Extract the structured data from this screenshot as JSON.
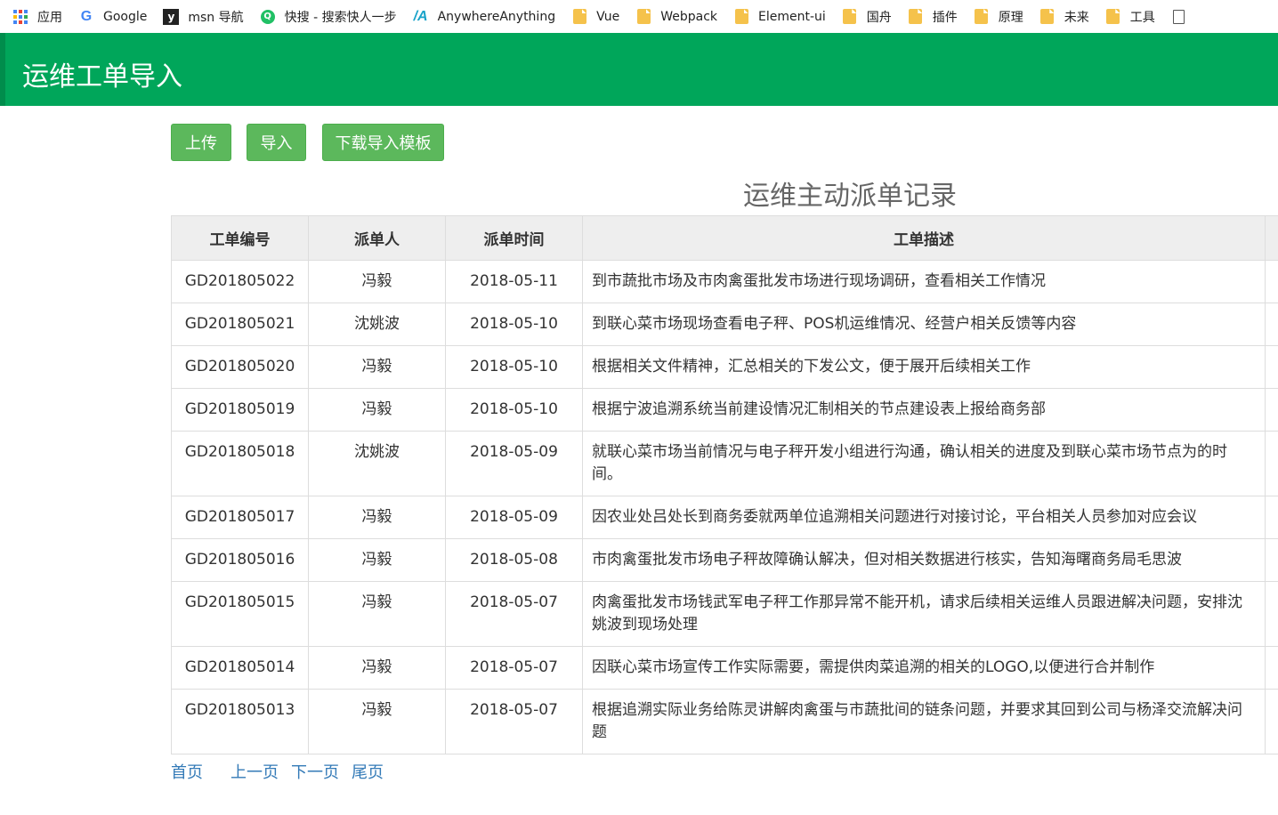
{
  "bookmarks": [
    {
      "label": "应用",
      "icon": "apps-grid-icon"
    },
    {
      "label": "Google",
      "icon": "google-icon"
    },
    {
      "label": "msn 导航",
      "icon": "msn-icon"
    },
    {
      "label": "快搜 - 搜索快人一步",
      "icon": "kuaisou-icon"
    },
    {
      "label": "AnywhereAnything",
      "icon": "anywhere-icon"
    },
    {
      "label": "Vue",
      "icon": "folder-icon"
    },
    {
      "label": "Webpack",
      "icon": "folder-icon"
    },
    {
      "label": "Element-ui",
      "icon": "folder-icon"
    },
    {
      "label": "国舟",
      "icon": "folder-icon"
    },
    {
      "label": "插件",
      "icon": "folder-icon"
    },
    {
      "label": "原理",
      "icon": "folder-icon"
    },
    {
      "label": "未来",
      "icon": "folder-icon"
    },
    {
      "label": "工具",
      "icon": "folder-icon"
    },
    {
      "label": "",
      "icon": "document-icon"
    }
  ],
  "header": {
    "title": "运维工单导入",
    "color": "#00a65a"
  },
  "toolbar": {
    "upload_label": "上传",
    "import_label": "导入",
    "template_label": "下载导入模板",
    "button_color": "#5cb85c"
  },
  "table": {
    "title": "运维主动派单记录",
    "columns": [
      "工单编号",
      "派单人",
      "派单时间",
      "工单描述"
    ],
    "rows": [
      {
        "id": "GD201805022",
        "person": "冯毅",
        "date": "2018-05-11",
        "desc": "到市蔬批市场及市肉禽蛋批发市场进行现场调研，查看相关工作情况"
      },
      {
        "id": "GD201805021",
        "person": "沈姚波",
        "date": "2018-05-10",
        "desc": "到联心菜市场现场查看电子秤、POS机运维情况、经营户相关反馈等内容"
      },
      {
        "id": "GD201805020",
        "person": "冯毅",
        "date": "2018-05-10",
        "desc": "根据相关文件精神，汇总相关的下发公文，便于展开后续相关工作"
      },
      {
        "id": "GD201805019",
        "person": "冯毅",
        "date": "2018-05-10",
        "desc": "根据宁波追溯系统当前建设情况汇制相关的节点建设表上报给商务部"
      },
      {
        "id": "GD201805018",
        "person": "沈姚波",
        "date": "2018-05-09",
        "desc": "就联心菜市场当前情况与电子秤开发小组进行沟通，确认相关的进度及到联心菜市场节点为的时间。"
      },
      {
        "id": "GD201805017",
        "person": "冯毅",
        "date": "2018-05-09",
        "desc": "因农业处吕处长到商务委就两单位追溯相关问题进行对接讨论，平台相关人员参加对应会议"
      },
      {
        "id": "GD201805016",
        "person": "冯毅",
        "date": "2018-05-08",
        "desc": "市肉禽蛋批发市场电子秤故障确认解决，但对相关数据进行核实，告知海曙商务局毛思波"
      },
      {
        "id": "GD201805015",
        "person": "冯毅",
        "date": "2018-05-07",
        "desc": "肉禽蛋批发市场钱武军电子秤工作那异常不能开机，请求后续相关运维人员跟进解决问题，安排沈姚波到现场处理"
      },
      {
        "id": "GD201805014",
        "person": "冯毅",
        "date": "2018-05-07",
        "desc": "因联心菜市场宣传工作实际需要，需提供肉菜追溯的相关的LOGO,以便进行合并制作"
      },
      {
        "id": "GD201805013",
        "person": "冯毅",
        "date": "2018-05-07",
        "desc": "根据追溯实际业务给陈灵讲解肉禽蛋与市蔬批间的链条问题，并要求其回到公司与杨泽交流解决问题"
      }
    ]
  },
  "pager": {
    "first": "首页",
    "prev": "上一页",
    "next": "下一页",
    "last": "尾页",
    "link_color": "#337ab7"
  }
}
